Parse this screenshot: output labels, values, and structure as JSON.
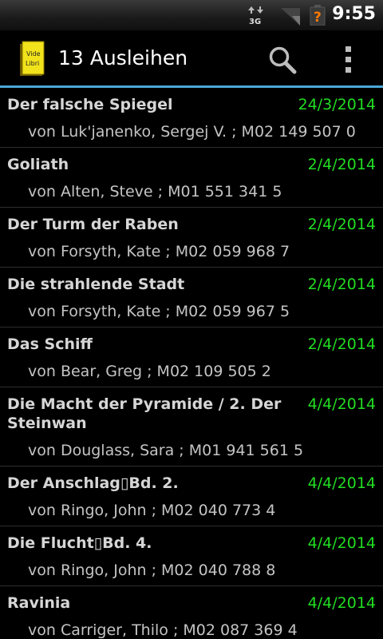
{
  "status": {
    "time": "9:55",
    "network": "3G"
  },
  "actionbar": {
    "title": "13 Ausleihen",
    "app_icon_text": "Vide Libri",
    "search_icon": "search-icon",
    "menu_icon": "overflow-menu-icon"
  },
  "colors": {
    "accent_line": "#4aa8d8",
    "date": "#22dd22"
  },
  "loans": [
    {
      "title": "Der falsche Spiegel",
      "date": "24/3/2014",
      "details": "von Luk'janenko, Sergej V. ; M02 149 507 0"
    },
    {
      "title": "Goliath",
      "date": "2/4/2014",
      "details": "von Alten, Steve ; M01 551 341 5"
    },
    {
      "title": "Der Turm der Raben",
      "date": "2/4/2014",
      "details": "von Forsyth, Kate ; M02 059 968 7"
    },
    {
      "title": "Die strahlende Stadt",
      "date": "2/4/2014",
      "details": "von Forsyth, Kate ; M02 059 967 5"
    },
    {
      "title": "Das Schiff",
      "date": "2/4/2014",
      "details": "von Bear, Greg ; M02 109 505 2"
    },
    {
      "title": "Die Macht der Pyramide / 2. Der Steinwan",
      "date": "4/4/2014",
      "details": "von Douglass, Sara ; M01 941 561 5"
    },
    {
      "title": "Der Anschlag▯Bd. 2.",
      "date": "4/4/2014",
      "details": "von Ringo, John ; M02 040 773 4"
    },
    {
      "title": "Die Flucht▯Bd. 4.",
      "date": "4/4/2014",
      "details": "von Ringo, John ; M02 040 788 8"
    },
    {
      "title": "Ravinia",
      "date": "4/4/2014",
      "details": "von Carriger, Thilo ; M02 087 369 4"
    }
  ]
}
